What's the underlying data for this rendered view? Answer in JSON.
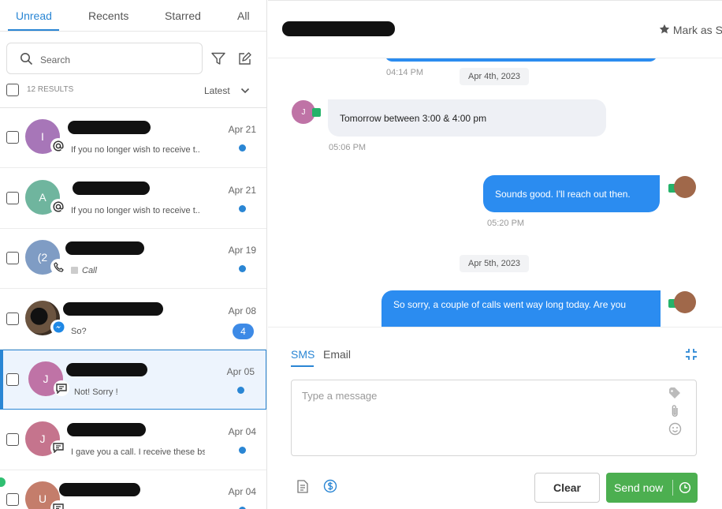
{
  "tabs": [
    "Unread",
    "Recents",
    "Starred",
    "All"
  ],
  "search": {
    "placeholder": "Search"
  },
  "results_label": "12 RESULTS",
  "sort_label": "Latest",
  "conversations": [
    {
      "initial": "I",
      "avatar_color": "#a776b8",
      "channel": "email",
      "date": "Apr 21",
      "preview": "If you no longer wish to receive t..",
      "unread_count": null,
      "selected": false
    },
    {
      "initial": "A",
      "avatar_color": "#6fb59e",
      "channel": "email",
      "date": "Apr 21",
      "preview": "If you no longer wish to receive t..",
      "unread_count": null,
      "selected": false
    },
    {
      "initial": "(2",
      "avatar_color": "#7f9cc4",
      "channel": "call",
      "date": "Apr 19",
      "preview": "Call",
      "unread_count": null,
      "selected": false
    },
    {
      "initial": "",
      "avatar_color": "#5a4636",
      "channel": "messenger",
      "date": "Apr 08",
      "preview": "So?",
      "unread_count": "4",
      "selected": false
    },
    {
      "initial": "J",
      "avatar_color": "#bf73a6",
      "channel": "sms",
      "date": "Apr 05",
      "preview": "Not! Sorry !",
      "unread_count": null,
      "selected": true
    },
    {
      "initial": "J",
      "avatar_color": "#c5748d",
      "channel": "sms",
      "date": "Apr 04",
      "preview": "I gave you a call. I receive these bs..",
      "unread_count": null,
      "selected": false
    },
    {
      "initial": "U",
      "avatar_color": "#c47d6b",
      "channel": "sms",
      "date": "Apr 04",
      "preview": "",
      "unread_count": null,
      "selected": false
    }
  ],
  "header": {
    "mark_label": "Mark as S"
  },
  "thread": {
    "ts1": "04:14 PM",
    "date1": "Apr 4th, 2023",
    "in_initial": "J",
    "msg_in": "Tomorrow between 3:00 & 4:00 pm",
    "ts2": "05:06 PM",
    "msg_out1": "Sounds good. I'll reach out then.",
    "ts3": "05:20 PM",
    "date2": "Apr 5th, 2023",
    "msg_out2": "So sorry, a couple of calls went way long today. Are you"
  },
  "composer": {
    "tabs": [
      "SMS",
      "Email"
    ],
    "placeholder": "Type a message",
    "clear_label": "Clear",
    "send_label": "Send now"
  },
  "colors": {
    "accent": "#2a86d4",
    "bubble_out": "#2b8cf0",
    "send": "#4caf50"
  }
}
